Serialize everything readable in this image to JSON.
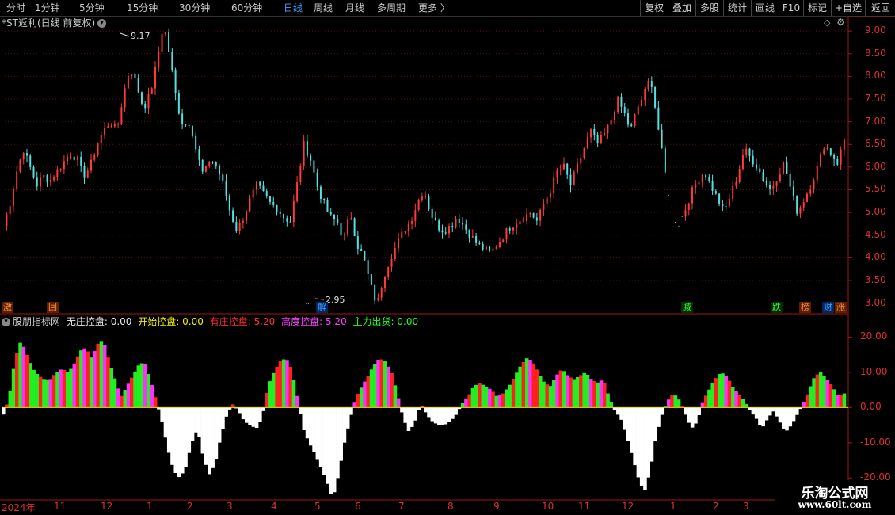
{
  "toolbar": {
    "periods": [
      "分时",
      "1分钟",
      "5分钟",
      "15分钟",
      "30分钟",
      "60分钟",
      "日线",
      "周线",
      "月线",
      "多周期",
      "更多 〉"
    ],
    "active_period": "日线",
    "right_buttons": [
      "复权",
      "叠加",
      "多股",
      "统计",
      "画线",
      "F10",
      "标记",
      "+自选",
      "返回"
    ]
  },
  "stock_title": "*ST返利(日线 前复权)",
  "price_high_label": "9.17",
  "price_low_label": "2.95",
  "price_axis": [
    "9.00",
    "8.50",
    "8.00",
    "7.50",
    "7.00",
    "6.50",
    "6.00",
    "5.50",
    "5.00",
    "4.50",
    "4.00",
    "3.50",
    "3.00"
  ],
  "indicator_axis": [
    "20.00",
    "10.00",
    "0.00",
    "-10.00",
    "-20.00"
  ],
  "indicator": {
    "name": "股朋指标网",
    "items": [
      {
        "label": "无庄控盘:",
        "value": "0.00",
        "color": "#e8e8e8"
      },
      {
        "label": "开始控盘:",
        "value": "0.00",
        "color": "#f0f000"
      },
      {
        "label": "有庄控盘:",
        "value": "5.20",
        "color": "#ff3030"
      },
      {
        "label": "高度控盘:",
        "value": "5.20",
        "color": "#ff40ff"
      },
      {
        "label": "主力出货:",
        "value": "0.00",
        "color": "#20ff20"
      }
    ]
  },
  "event_tags": [
    {
      "text": "激",
      "color": "#ff9040",
      "bg": "#602000"
    },
    {
      "text": "回",
      "color": "#ff9040",
      "bg": "#602000"
    },
    {
      "text": "解",
      "color": "#40a0ff",
      "bg": "#002860"
    },
    {
      "text": "减",
      "color": "#40ff40",
      "bg": "#003000"
    },
    {
      "text": "跌",
      "color": "#40ff40",
      "bg": "#003000"
    },
    {
      "text": "榜",
      "color": "#ff9040",
      "bg": "#602000"
    },
    {
      "text": "财",
      "color": "#40a0ff",
      "bg": "#002860"
    },
    {
      "text": "涨",
      "color": "#ff9040",
      "bg": "#602000"
    }
  ],
  "x_axis_labels": [
    "2024年",
    "11",
    "12",
    "1",
    "2",
    "3",
    "4",
    "5",
    "6",
    "7",
    "8",
    "9",
    "10",
    "11",
    "12",
    "1",
    "2",
    "3"
  ],
  "watermark": {
    "line1": "乐淘公式网",
    "line2": "www.60lt.com"
  },
  "chart_data": {
    "type": "candlestick+histogram",
    "price_ylim": [
      2.8,
      9.3
    ],
    "price_path": [
      4.7,
      5.2,
      5.9,
      6.4,
      6.0,
      5.6,
      5.8,
      5.7,
      5.9,
      6.1,
      6.3,
      6.2,
      5.8,
      6.0,
      6.5,
      6.8,
      7.0,
      6.8,
      7.6,
      8.2,
      7.8,
      7.3,
      7.6,
      8.3,
      9.17,
      8.4,
      7.4,
      6.9,
      7.0,
      6.3,
      5.8,
      6.2,
      6.0,
      5.6,
      5.0,
      4.6,
      4.9,
      5.3,
      5.6,
      5.4,
      5.2,
      5.1,
      4.9,
      4.8,
      5.6,
      6.5,
      6.2,
      5.6,
      5.2,
      4.9,
      4.8,
      4.4,
      5.0,
      4.3,
      4.0,
      3.4,
      2.95,
      3.6,
      4.0,
      4.3,
      4.6,
      4.8,
      5.2,
      5.5,
      5.0,
      4.7,
      4.6,
      4.7,
      4.9,
      4.7,
      4.5,
      4.3,
      4.2,
      4.1,
      4.3,
      4.5,
      4.7,
      4.8,
      4.9,
      5.0,
      4.8,
      5.2,
      5.5,
      5.9,
      6.0,
      5.6,
      6.0,
      6.4,
      6.8,
      6.5,
      6.7,
      7.0,
      7.5,
      7.2,
      6.8,
      7.3,
      7.6,
      8.0,
      7.0,
      6.0,
      5.2,
      4.7,
      5.0,
      5.4,
      5.7,
      5.9,
      5.6,
      5.3,
      5.0,
      5.4,
      5.8,
      6.4,
      6.2,
      6.0,
      5.7,
      5.5,
      5.8,
      6.1,
      5.5,
      5.0,
      5.3,
      5.6,
      6.0,
      6.5,
      6.3,
      6.1,
      6.6
    ],
    "indicator_ylim": [
      -26,
      23
    ],
    "indicator_path": [
      -2,
      3,
      14,
      19,
      15,
      11,
      9,
      8,
      8,
      10,
      11,
      10,
      12,
      16,
      17,
      14,
      18,
      19,
      13,
      8,
      3,
      6,
      9,
      12,
      13,
      8,
      2,
      -4,
      -12,
      -18,
      -20,
      -17,
      -10,
      -6,
      -14,
      -19,
      -16,
      -8,
      -2,
      1,
      -1,
      -4,
      -5,
      -6,
      -3,
      6,
      10,
      13,
      14,
      11,
      3,
      -6,
      -10,
      -13,
      -17,
      -21,
      -26,
      -19,
      -10,
      -3,
      3,
      6,
      9,
      12,
      14,
      13,
      10,
      4,
      -3,
      -7,
      -4,
      1,
      -2,
      -4,
      -5,
      -5,
      -4,
      -2,
      1,
      3,
      6,
      7,
      6,
      5,
      3,
      4,
      6,
      9,
      12,
      14,
      13,
      10,
      7,
      6,
      9,
      11,
      9,
      8,
      9,
      10,
      8,
      7,
      8,
      3,
      -1,
      -3,
      -8,
      -14,
      -20,
      -24,
      -18,
      -8,
      -2,
      2,
      4,
      2,
      -2,
      -6,
      -4,
      2,
      5,
      8,
      10,
      9,
      6,
      4,
      2,
      -1,
      -3,
      -6,
      -3,
      -1,
      -4,
      -7,
      -5,
      -2,
      1,
      5,
      9,
      10,
      8,
      6,
      3,
      4
    ]
  }
}
